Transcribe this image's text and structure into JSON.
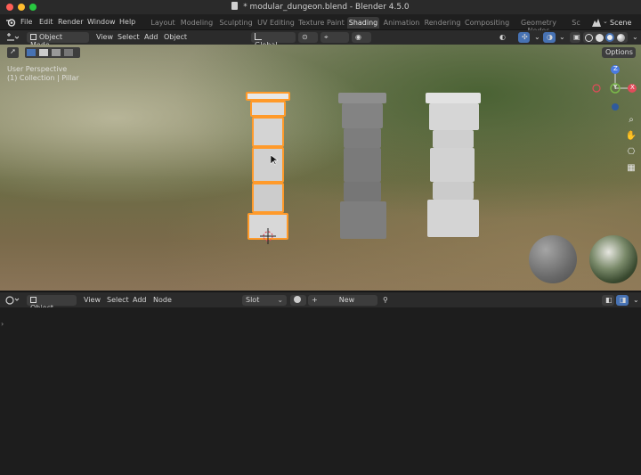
{
  "window": {
    "title": "* modular_dungeon.blend - Blender 4.5.0"
  },
  "menubar": {
    "app_icon": "blender-icon",
    "menus": [
      "File",
      "Edit",
      "Render",
      "Window",
      "Help"
    ],
    "workspaces": [
      "Layout",
      "Modeling",
      "Sculpting",
      "UV Editing",
      "Texture Paint",
      "Shading",
      "Animation",
      "Rendering",
      "Compositing",
      "Geometry Nodes",
      "Sc"
    ],
    "active_workspace": "Shading",
    "scene_label": "Scene"
  },
  "viewport_header": {
    "mode": "Object Mode",
    "menus": [
      "View",
      "Select",
      "Add",
      "Object"
    ],
    "orientation": "Global",
    "options_label": "Options"
  },
  "viewport": {
    "overlay_line1": "User Perspective",
    "overlay_line2": "(1) Collection | Pillar",
    "gizmo_axes": [
      "Z",
      "Y",
      "X"
    ],
    "nav_icons": [
      "zoom-icon",
      "hand-icon",
      "camera-icon",
      "grid-icon"
    ]
  },
  "node_editor_header": {
    "type": "Object",
    "menus": [
      "View",
      "Select",
      "Add",
      "Node"
    ],
    "slot_label": "Slot",
    "new_label": "New"
  },
  "colors": {
    "accent": "#4772b3",
    "selection": "#ff9a2a",
    "axis_x": "#e14b5a",
    "axis_y": "#7ab84a",
    "axis_z": "#4a7ae1"
  }
}
